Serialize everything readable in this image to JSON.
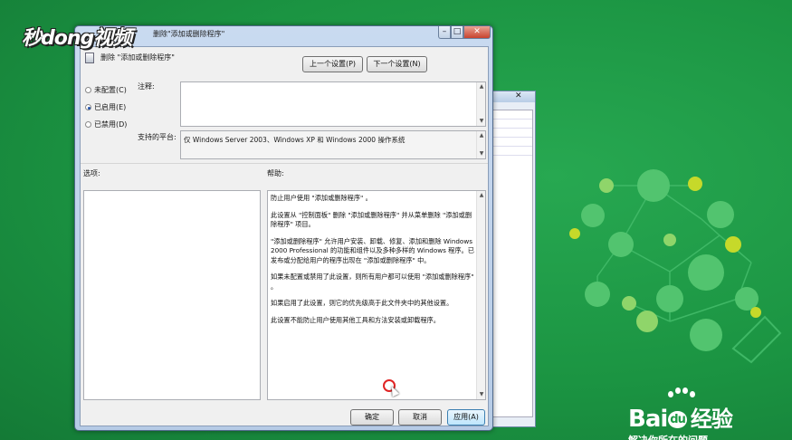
{
  "watermark": "秒dong视频",
  "dialog": {
    "title": "删除\"添加或删除程序\"",
    "setting_title": "删除 \"添加或删除程序\"",
    "prev_button": "上一个设置(P)",
    "next_button": "下一个设置(N)",
    "radios": [
      {
        "label": "未配置(C)",
        "selected": false
      },
      {
        "label": "已启用(E)",
        "selected": true
      },
      {
        "label": "已禁用(D)",
        "selected": false
      }
    ],
    "comment_label": "注释:",
    "comment_value": "",
    "platform_label": "支持的平台:",
    "platform_value": "仅 Windows Server 2003、Windows XP 和 Windows 2000 操作系统",
    "options_label": "选项:",
    "help_label": "帮助:",
    "help_paragraphs": [
      "防止用户使用 \"添加或删除程序\" 。",
      "此设置从 \"控制面板\" 删除 \"添加或删除程序\" 并从菜单删除 \"添加或删除程序\" 项目。",
      "\"添加或删除程序\" 允许用户安装、卸载、修复、添加和删除 Windows 2000 Professional 的功能和组件以及多种多样的 Windows 程序。已发布或分配给用户的程序出现在 \"添加或删除程序\" 中。",
      "如果未配置或禁用了此设置，则所有用户都可以使用 \"添加或删除程序\" 。",
      "如果启用了此设置，则它的优先级高于此文件夹中的其他设置。",
      "此设置不能防止用户使用其他工具和方法安装或卸载程序。"
    ],
    "ok_button": "确定",
    "cancel_button": "取消",
    "apply_button": "应用(A)"
  },
  "brand": {
    "logo_text_1": "Bai",
    "logo_du": "du",
    "logo_text_2": "经验",
    "slogan": "解决你所在的问题"
  },
  "colors": {
    "background": "#1e9a45",
    "accent": "#c6d92a"
  }
}
